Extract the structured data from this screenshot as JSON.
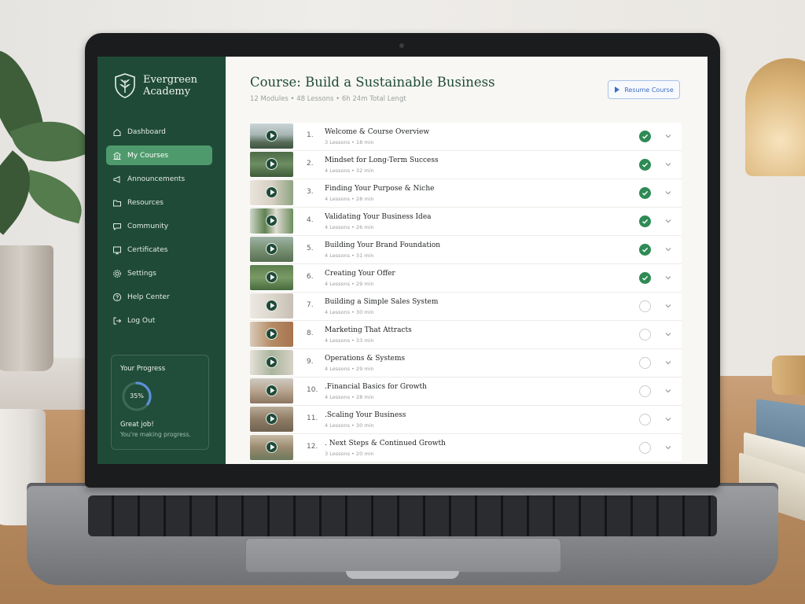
{
  "brand": {
    "line1": "Evergreen",
    "line2": "Academy"
  },
  "sidebar": {
    "items": [
      {
        "label": "Dashboard",
        "icon": "home-icon",
        "active": false
      },
      {
        "label": "My Courses",
        "icon": "courses-icon",
        "active": true
      },
      {
        "label": "Announcements",
        "icon": "megaphone-icon",
        "active": false
      },
      {
        "label": "Resources",
        "icon": "folder-icon",
        "active": false
      },
      {
        "label": "Community",
        "icon": "chat-icon",
        "active": false
      },
      {
        "label": "Certificates",
        "icon": "certificate-icon",
        "active": false
      },
      {
        "label": "Settings",
        "icon": "gear-icon",
        "active": false
      },
      {
        "label": "Help Center",
        "icon": "help-icon",
        "active": false
      },
      {
        "label": "Log Out",
        "icon": "logout-icon",
        "active": false
      }
    ]
  },
  "progress": {
    "title": "Your Progress",
    "percent_label": "35%",
    "percent_value": 35,
    "message": "Great job!",
    "submessage": "You're making progress."
  },
  "course": {
    "title": "Course: Build a Sustainable Business",
    "meta": "12 Modules • 48 Lessons • 6h 24m Total Lengt",
    "resume_label": "Resume Course"
  },
  "modules": [
    {
      "num": "1.",
      "title": "Welcome & Course Overview",
      "sub": "3 Lessons • 18 min",
      "done": true
    },
    {
      "num": "2.",
      "title": "Mindset for Long-Term Success",
      "sub": "4 Lessons • 32 min",
      "done": true
    },
    {
      "num": "3.",
      "title": "Finding Your Purpose & Niche",
      "sub": "4 Lessons • 28 min",
      "done": true
    },
    {
      "num": "4.",
      "title": "Validating Your Business Idea",
      "sub": "4 Lessons • 26 min",
      "done": true
    },
    {
      "num": "5.",
      "title": "Building Your Brand Foundation",
      "sub": "4 Lessons • 31 min",
      "done": true
    },
    {
      "num": "6.",
      "title": "Creating Your Offer",
      "sub": "4 Lessons • 29 min",
      "done": true
    },
    {
      "num": "7.",
      "title": "Building a Simple Sales System",
      "sub": "4 Lessons • 30 min",
      "done": false
    },
    {
      "num": "8.",
      "title": "Marketing That Attracts",
      "sub": "4 Lessons • 33 min",
      "done": false
    },
    {
      "num": "9.",
      "title": "Operations & Systems",
      "sub": "4 Lessons • 29 min",
      "done": false
    },
    {
      "num": "10.",
      "title": ".Financial Basics for Growth",
      "sub": "4 Lessons • 28 min",
      "done": false
    },
    {
      "num": "11.",
      "title": ".Scaling Your Business",
      "sub": "4 Lessons • 30 min",
      "done": false
    },
    {
      "num": "12.",
      "title": ". Next Steps & Continued Growth",
      "sub": "3 Lessons • 20 min",
      "done": false
    }
  ],
  "colors": {
    "sidebar_bg": "#1f4a38",
    "active_item": "#4f9a6c",
    "complete": "#2f8a55",
    "accent_blue": "#3d6fc2"
  }
}
